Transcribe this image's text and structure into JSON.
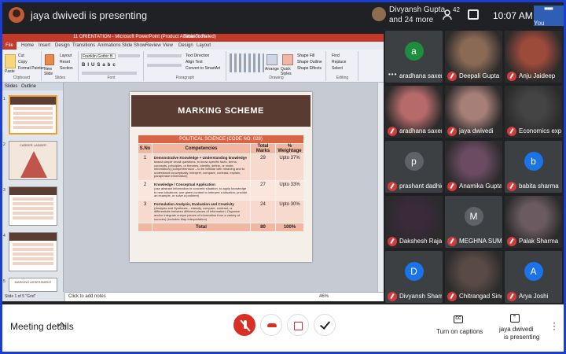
{
  "topbar": {
    "presenter_text": "jaya dwivedi is presenting",
    "participant_name": "Divyansh Gupta",
    "participant_more": "and 24 more",
    "people_count": "42",
    "time": "10:07 AM",
    "you_label": "You"
  },
  "powerpoint": {
    "window_title": "11 ORIENTATION - Microsoft PowerPoint (Product Activation Failed)",
    "tool_tab": "Table Tools",
    "file_tab": "File",
    "tabs": [
      "Home",
      "Insert",
      "Design",
      "Transitions",
      "Animations",
      "Slide Show",
      "Review",
      "View",
      "Design",
      "Layout"
    ],
    "groups": [
      "Clipboard",
      "Slides",
      "Font",
      "Paragraph",
      "Drawing",
      "Editing"
    ],
    "ribbon_items": {
      "paste": "Paste",
      "cut": "Cut",
      "copy": "Copy",
      "format_painter": "Format Painter",
      "new_slide": "New Slide",
      "layout": "Layout",
      "reset": "Reset",
      "section": "Section",
      "font_name": "Franklin Gothic B",
      "text_direction": "Text Direction",
      "align_text": "Align Text",
      "convert_smartart": "Convert to SmartArt",
      "arrange": "Arrange",
      "quick_styles": "Quick Styles",
      "shape_fill": "Shape Fill",
      "shape_outline": "Shape Outline",
      "shape_effects": "Shape Effects",
      "find": "Find",
      "replace": "Replace",
      "select": "Select"
    },
    "panel_tabs": [
      "Slides",
      "Outline"
    ],
    "thumb2_title": "CAREER LADDER",
    "thumb5_title": "MARKING ASSESSMENT",
    "notes_placeholder": "Click to add notes",
    "status_text": "Slide 1 of 5   \"Grid\"",
    "zoom": "46%"
  },
  "slide": {
    "title": "MARKING SCHEME",
    "table_caption": "POLITICAL SCIENCE (CODE NO. 028)",
    "headers": [
      "S.No",
      "Competencies",
      "Total Marks",
      "% Weightage"
    ],
    "rows": [
      {
        "sno": "1",
        "title": "Demonstrative Knowledge + Understanding knowledge",
        "desc": "based simple recall questions, to know specific facts, terms, concepts, principles, or theories, identify, define, or recite, information) (comprehension – to be familiar with meaning and to understand conceptually, interpret, compare, contrast, explain, paraphrase information)",
        "marks": "29",
        "weight": "Upto 37%"
      },
      {
        "sno": "2",
        "title": "Knowledge / Conceptual Application",
        "desc": "(use abstract information in concrete situation, to apply knowledge to new situations; use given content to interpret a situation, provide an example, or solve a problem)",
        "marks": "27",
        "weight": "Upto 33%"
      },
      {
        "sno": "3",
        "title": "Formulation Analysis, Evaluation and Creativity",
        "desc": "(Analysis and Synthesis – classify, compare, contrast, or differentiate between different pieces of information; Organize and/or integrate unique pieces of information from a variety of sources) (includes Map interpretation)",
        "marks": "24",
        "weight": "Upto 30%"
      }
    ],
    "total_label": "Total",
    "total_marks": "80",
    "total_weight": "100%"
  },
  "participants": [
    {
      "name": "aradhana saxena",
      "initial": "a",
      "color": "#1e8e3e",
      "photo": false
    },
    {
      "name": "Deepali Gupta",
      "initial": "",
      "color": "#8a6a55",
      "photo": true
    },
    {
      "name": "Anju Jaideep",
      "initial": "",
      "color": "#9c4a3a",
      "photo": true
    },
    {
      "name": "aradhana saxena",
      "initial": "",
      "color": "#b66a6a",
      "photo": true
    },
    {
      "name": "jaya dwivedi",
      "initial": "",
      "color": "#a67f78",
      "photo": true
    },
    {
      "name": "Economics expe...",
      "initial": "",
      "color": "#444",
      "photo": true
    },
    {
      "name": "prashant dadhich",
      "initial": "p",
      "color": "#5f6368",
      "photo": false
    },
    {
      "name": "Anamika Gupta",
      "initial": "",
      "color": "#6a4b62",
      "photo": true
    },
    {
      "name": "babita sharma",
      "initial": "b",
      "color": "#1a73e8",
      "photo": false
    },
    {
      "name": "Dakshesh Rajal",
      "initial": "",
      "color": "#3a2a3a",
      "photo": true
    },
    {
      "name": "MEGHNA SUMAN",
      "initial": "M",
      "color": "#5f6368",
      "photo": false
    },
    {
      "name": "Palak Sharma",
      "initial": "",
      "color": "#6b5b60",
      "photo": true
    },
    {
      "name": "Divyansh Sharma",
      "initial": "D",
      "color": "#1a73e8",
      "photo": false
    },
    {
      "name": "Chitrangad Singh",
      "initial": "",
      "color": "#5a4a46",
      "photo": true
    },
    {
      "name": "Arya Joshi",
      "initial": "A",
      "color": "#1a73e8",
      "photo": false
    }
  ],
  "bottombar": {
    "meeting_details": "Meeting details",
    "captions": "Turn on captions",
    "presenting_1": "jaya dwivedi",
    "presenting_2": "is presenting",
    "cc": "CC"
  }
}
